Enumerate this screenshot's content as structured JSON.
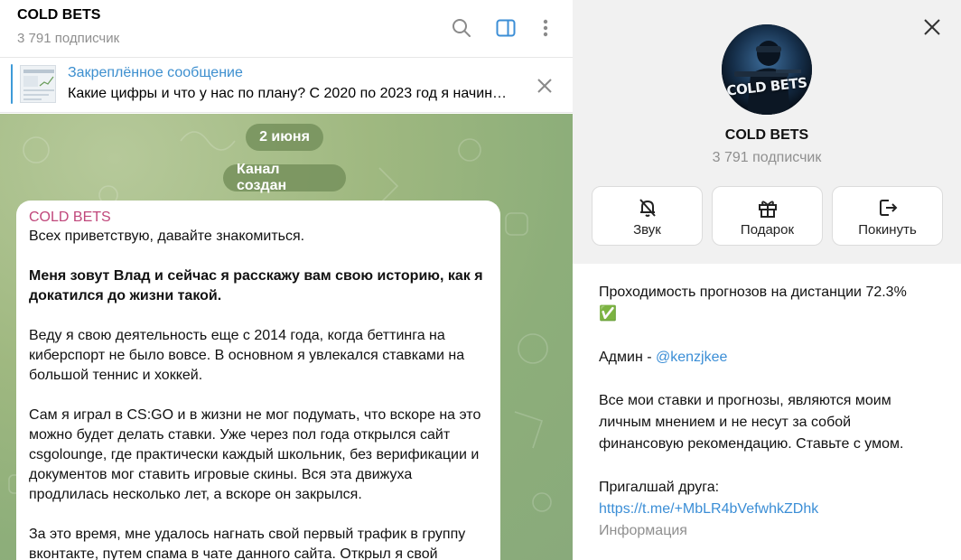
{
  "chat": {
    "title": "COLD BETS",
    "subscribers": "3 791 подписчик",
    "pinned": {
      "title": "Закреплённое сообщение",
      "text": "Какие цифры и что у нас по плану?  С 2020 по 2023 год я начинал..."
    },
    "date_pill": "2 июня",
    "service_pill": "Канал создан",
    "message": {
      "author": "COLD BETS",
      "paragraphs": [
        "Всех приветствую, давайте знакомиться.",
        "Меня зовут Влад и сейчас я расскажу вам свою историю, как я докатился до жизни такой.",
        "Веду я свою деятельность еще с 2014 года, когда беттинга на киберспорт не было вовсе. В основном я увлекался ставками на большой теннис и хоккей.",
        "Сам я играл в CS:GO и в жизни не мог подумать, что вскоре на это можно будет делать ставки. Уже через пол года открылся сайт csgolounge, где практически каждый школьник, без верификации и документов мог ставить игровые скины. Вся эта движуха продлилась несколько лет, а вскоре он закрылся.",
        "За это время, мне удалось нагнать свой первый трафик в группу вконтакте, путем спама в чате данного сайта. Открыл я свой"
      ]
    }
  },
  "panel": {
    "avatar_text": "COLD BETS",
    "title": "COLD BETS",
    "subscribers": "3 791 подписчик",
    "actions": [
      {
        "label": "Звук",
        "icon": "bell-off-icon"
      },
      {
        "label": "Подарок",
        "icon": "gift-icon"
      },
      {
        "label": "Покинуть",
        "icon": "leave-icon"
      }
    ],
    "info": {
      "line1": "Проходимость прогнозов на дистанции 72.3%",
      "check": "✅",
      "admin_prefix": "Админ - ",
      "admin_handle": "@kenzjkee",
      "disclaimer": "Все мои ставки и прогнозы, являются моим личным мнением и не несут за собой финансовую рекомендацию. Ставьте с умом.",
      "invite_label": "Пригалшай друга:",
      "invite_link": "https://t.me/+MbLR4bVefwhkZDhk",
      "section_label": "Информация"
    }
  },
  "colors": {
    "accent": "#3b8ed6",
    "author": "#c0477b",
    "muted": "#8f8f8f",
    "chat_bg": "#9fb880"
  }
}
